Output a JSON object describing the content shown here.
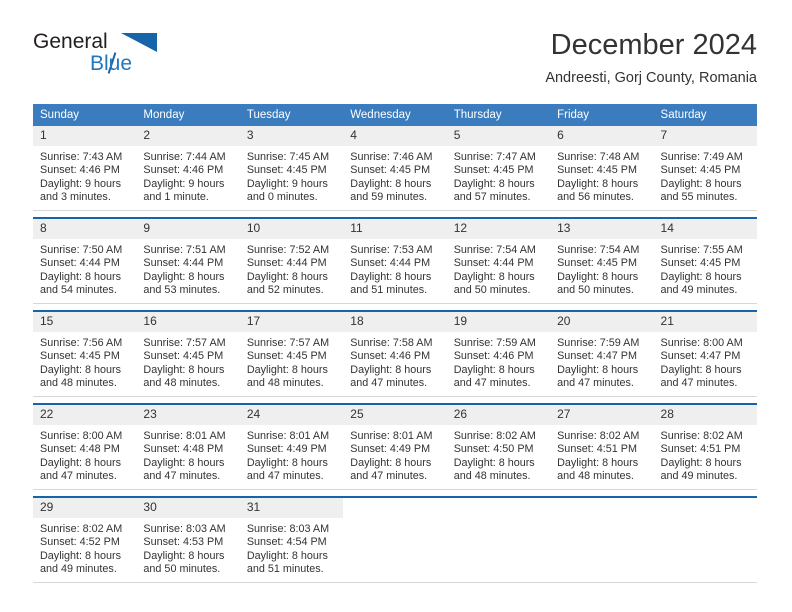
{
  "brand": {
    "name_top": "General",
    "name_bottom": "Blue",
    "logo_icon": "triangle-logo-icon"
  },
  "header": {
    "month_title": "December 2024",
    "location": "Andreesti, Gorj County, Romania"
  },
  "colors": {
    "header_blue": "#3a7cbe",
    "row_divider_blue": "#1565a8",
    "daynum_band": "#efefef",
    "text": "#333333",
    "brand_blue": "#2178bd"
  },
  "calendar": {
    "weekday_headers": [
      "Sunday",
      "Monday",
      "Tuesday",
      "Wednesday",
      "Thursday",
      "Friday",
      "Saturday"
    ],
    "labels": {
      "sunrise_prefix": "Sunrise:",
      "sunset_prefix": "Sunset:",
      "daylight_prefix": "Daylight:"
    },
    "weeks": [
      [
        {
          "day": "1",
          "sunrise": "Sunrise: 7:43 AM",
          "sunset": "Sunset: 4:46 PM",
          "daylight_l1": "Daylight: 9 hours",
          "daylight_l2": "and 3 minutes."
        },
        {
          "day": "2",
          "sunrise": "Sunrise: 7:44 AM",
          "sunset": "Sunset: 4:46 PM",
          "daylight_l1": "Daylight: 9 hours",
          "daylight_l2": "and 1 minute."
        },
        {
          "day": "3",
          "sunrise": "Sunrise: 7:45 AM",
          "sunset": "Sunset: 4:45 PM",
          "daylight_l1": "Daylight: 9 hours",
          "daylight_l2": "and 0 minutes."
        },
        {
          "day": "4",
          "sunrise": "Sunrise: 7:46 AM",
          "sunset": "Sunset: 4:45 PM",
          "daylight_l1": "Daylight: 8 hours",
          "daylight_l2": "and 59 minutes."
        },
        {
          "day": "5",
          "sunrise": "Sunrise: 7:47 AM",
          "sunset": "Sunset: 4:45 PM",
          "daylight_l1": "Daylight: 8 hours",
          "daylight_l2": "and 57 minutes."
        },
        {
          "day": "6",
          "sunrise": "Sunrise: 7:48 AM",
          "sunset": "Sunset: 4:45 PM",
          "daylight_l1": "Daylight: 8 hours",
          "daylight_l2": "and 56 minutes."
        },
        {
          "day": "7",
          "sunrise": "Sunrise: 7:49 AM",
          "sunset": "Sunset: 4:45 PM",
          "daylight_l1": "Daylight: 8 hours",
          "daylight_l2": "and 55 minutes."
        }
      ],
      [
        {
          "day": "8",
          "sunrise": "Sunrise: 7:50 AM",
          "sunset": "Sunset: 4:44 PM",
          "daylight_l1": "Daylight: 8 hours",
          "daylight_l2": "and 54 minutes."
        },
        {
          "day": "9",
          "sunrise": "Sunrise: 7:51 AM",
          "sunset": "Sunset: 4:44 PM",
          "daylight_l1": "Daylight: 8 hours",
          "daylight_l2": "and 53 minutes."
        },
        {
          "day": "10",
          "sunrise": "Sunrise: 7:52 AM",
          "sunset": "Sunset: 4:44 PM",
          "daylight_l1": "Daylight: 8 hours",
          "daylight_l2": "and 52 minutes."
        },
        {
          "day": "11",
          "sunrise": "Sunrise: 7:53 AM",
          "sunset": "Sunset: 4:44 PM",
          "daylight_l1": "Daylight: 8 hours",
          "daylight_l2": "and 51 minutes."
        },
        {
          "day": "12",
          "sunrise": "Sunrise: 7:54 AM",
          "sunset": "Sunset: 4:44 PM",
          "daylight_l1": "Daylight: 8 hours",
          "daylight_l2": "and 50 minutes."
        },
        {
          "day": "13",
          "sunrise": "Sunrise: 7:54 AM",
          "sunset": "Sunset: 4:45 PM",
          "daylight_l1": "Daylight: 8 hours",
          "daylight_l2": "and 50 minutes."
        },
        {
          "day": "14",
          "sunrise": "Sunrise: 7:55 AM",
          "sunset": "Sunset: 4:45 PM",
          "daylight_l1": "Daylight: 8 hours",
          "daylight_l2": "and 49 minutes."
        }
      ],
      [
        {
          "day": "15",
          "sunrise": "Sunrise: 7:56 AM",
          "sunset": "Sunset: 4:45 PM",
          "daylight_l1": "Daylight: 8 hours",
          "daylight_l2": "and 48 minutes."
        },
        {
          "day": "16",
          "sunrise": "Sunrise: 7:57 AM",
          "sunset": "Sunset: 4:45 PM",
          "daylight_l1": "Daylight: 8 hours",
          "daylight_l2": "and 48 minutes."
        },
        {
          "day": "17",
          "sunrise": "Sunrise: 7:57 AM",
          "sunset": "Sunset: 4:45 PM",
          "daylight_l1": "Daylight: 8 hours",
          "daylight_l2": "and 48 minutes."
        },
        {
          "day": "18",
          "sunrise": "Sunrise: 7:58 AM",
          "sunset": "Sunset: 4:46 PM",
          "daylight_l1": "Daylight: 8 hours",
          "daylight_l2": "and 47 minutes."
        },
        {
          "day": "19",
          "sunrise": "Sunrise: 7:59 AM",
          "sunset": "Sunset: 4:46 PM",
          "daylight_l1": "Daylight: 8 hours",
          "daylight_l2": "and 47 minutes."
        },
        {
          "day": "20",
          "sunrise": "Sunrise: 7:59 AM",
          "sunset": "Sunset: 4:47 PM",
          "daylight_l1": "Daylight: 8 hours",
          "daylight_l2": "and 47 minutes."
        },
        {
          "day": "21",
          "sunrise": "Sunrise: 8:00 AM",
          "sunset": "Sunset: 4:47 PM",
          "daylight_l1": "Daylight: 8 hours",
          "daylight_l2": "and 47 minutes."
        }
      ],
      [
        {
          "day": "22",
          "sunrise": "Sunrise: 8:00 AM",
          "sunset": "Sunset: 4:48 PM",
          "daylight_l1": "Daylight: 8 hours",
          "daylight_l2": "and 47 minutes."
        },
        {
          "day": "23",
          "sunrise": "Sunrise: 8:01 AM",
          "sunset": "Sunset: 4:48 PM",
          "daylight_l1": "Daylight: 8 hours",
          "daylight_l2": "and 47 minutes."
        },
        {
          "day": "24",
          "sunrise": "Sunrise: 8:01 AM",
          "sunset": "Sunset: 4:49 PM",
          "daylight_l1": "Daylight: 8 hours",
          "daylight_l2": "and 47 minutes."
        },
        {
          "day": "25",
          "sunrise": "Sunrise: 8:01 AM",
          "sunset": "Sunset: 4:49 PM",
          "daylight_l1": "Daylight: 8 hours",
          "daylight_l2": "and 47 minutes."
        },
        {
          "day": "26",
          "sunrise": "Sunrise: 8:02 AM",
          "sunset": "Sunset: 4:50 PM",
          "daylight_l1": "Daylight: 8 hours",
          "daylight_l2": "and 48 minutes."
        },
        {
          "day": "27",
          "sunrise": "Sunrise: 8:02 AM",
          "sunset": "Sunset: 4:51 PM",
          "daylight_l1": "Daylight: 8 hours",
          "daylight_l2": "and 48 minutes."
        },
        {
          "day": "28",
          "sunrise": "Sunrise: 8:02 AM",
          "sunset": "Sunset: 4:51 PM",
          "daylight_l1": "Daylight: 8 hours",
          "daylight_l2": "and 49 minutes."
        }
      ],
      [
        {
          "day": "29",
          "sunrise": "Sunrise: 8:02 AM",
          "sunset": "Sunset: 4:52 PM",
          "daylight_l1": "Daylight: 8 hours",
          "daylight_l2": "and 49 minutes."
        },
        {
          "day": "30",
          "sunrise": "Sunrise: 8:03 AM",
          "sunset": "Sunset: 4:53 PM",
          "daylight_l1": "Daylight: 8 hours",
          "daylight_l2": "and 50 minutes."
        },
        {
          "day": "31",
          "sunrise": "Sunrise: 8:03 AM",
          "sunset": "Sunset: 4:54 PM",
          "daylight_l1": "Daylight: 8 hours",
          "daylight_l2": "and 51 minutes."
        },
        {
          "day": "",
          "sunrise": "",
          "sunset": "",
          "daylight_l1": "",
          "daylight_l2": ""
        },
        {
          "day": "",
          "sunrise": "",
          "sunset": "",
          "daylight_l1": "",
          "daylight_l2": ""
        },
        {
          "day": "",
          "sunrise": "",
          "sunset": "",
          "daylight_l1": "",
          "daylight_l2": ""
        },
        {
          "day": "",
          "sunrise": "",
          "sunset": "",
          "daylight_l1": "",
          "daylight_l2": ""
        }
      ]
    ]
  }
}
